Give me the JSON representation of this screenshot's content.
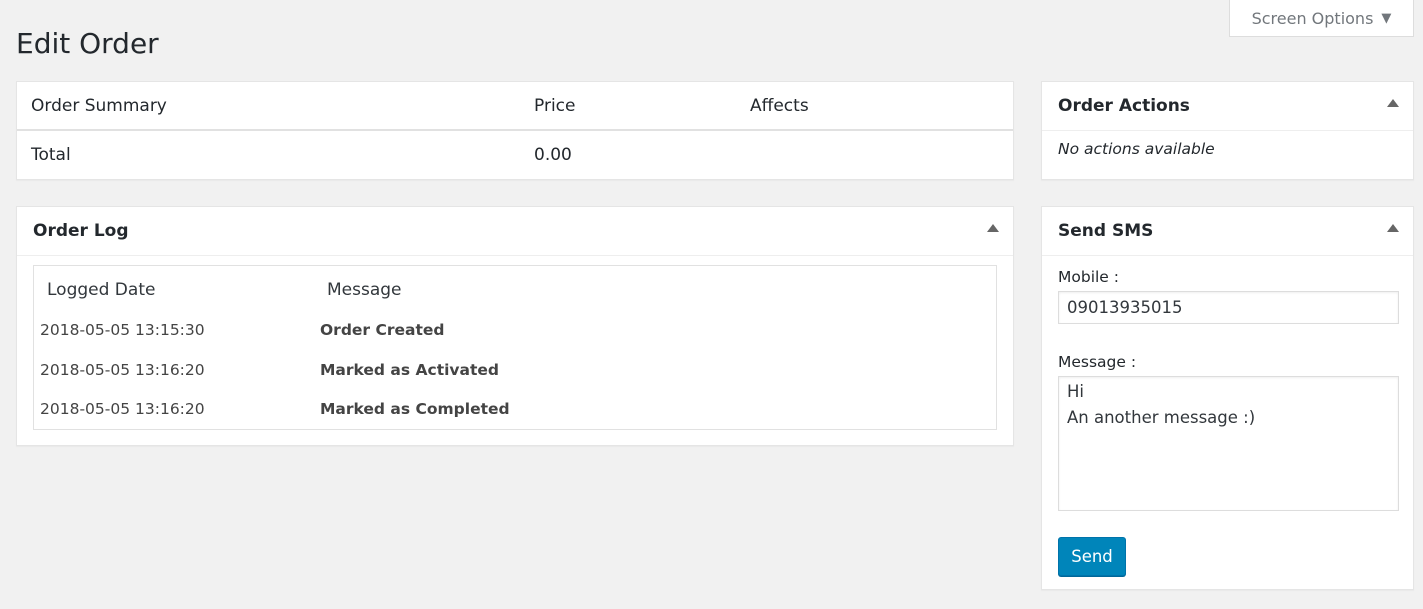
{
  "screen_options": {
    "label": "Screen Options",
    "icon": "caret-down-icon"
  },
  "page": {
    "title": "Edit Order"
  },
  "summary": {
    "headers": {
      "name": "Order Summary",
      "price": "Price",
      "affects": "Affects"
    },
    "total": {
      "label": "Total",
      "price": "0.00",
      "affects": ""
    }
  },
  "order_log": {
    "title": "Order Log",
    "columns": {
      "date": "Logged Date",
      "message": "Message"
    },
    "rows": [
      {
        "date": "2018-05-05 13:15:30",
        "message": "Order Created"
      },
      {
        "date": "2018-05-05 13:16:20",
        "message": "Marked as Activated"
      },
      {
        "date": "2018-05-05 13:16:20",
        "message": "Marked as Completed"
      }
    ]
  },
  "order_actions": {
    "title": "Order Actions",
    "empty": "No actions available"
  },
  "send_sms": {
    "title": "Send SMS",
    "mobile_label": "Mobile :",
    "mobile_value": "09013935015",
    "message_label": "Message :",
    "message_value": "Hi\nAn another message :)",
    "send_label": "Send"
  },
  "colors": {
    "primary_button": "#0085ba",
    "background": "#f1f1f1"
  }
}
